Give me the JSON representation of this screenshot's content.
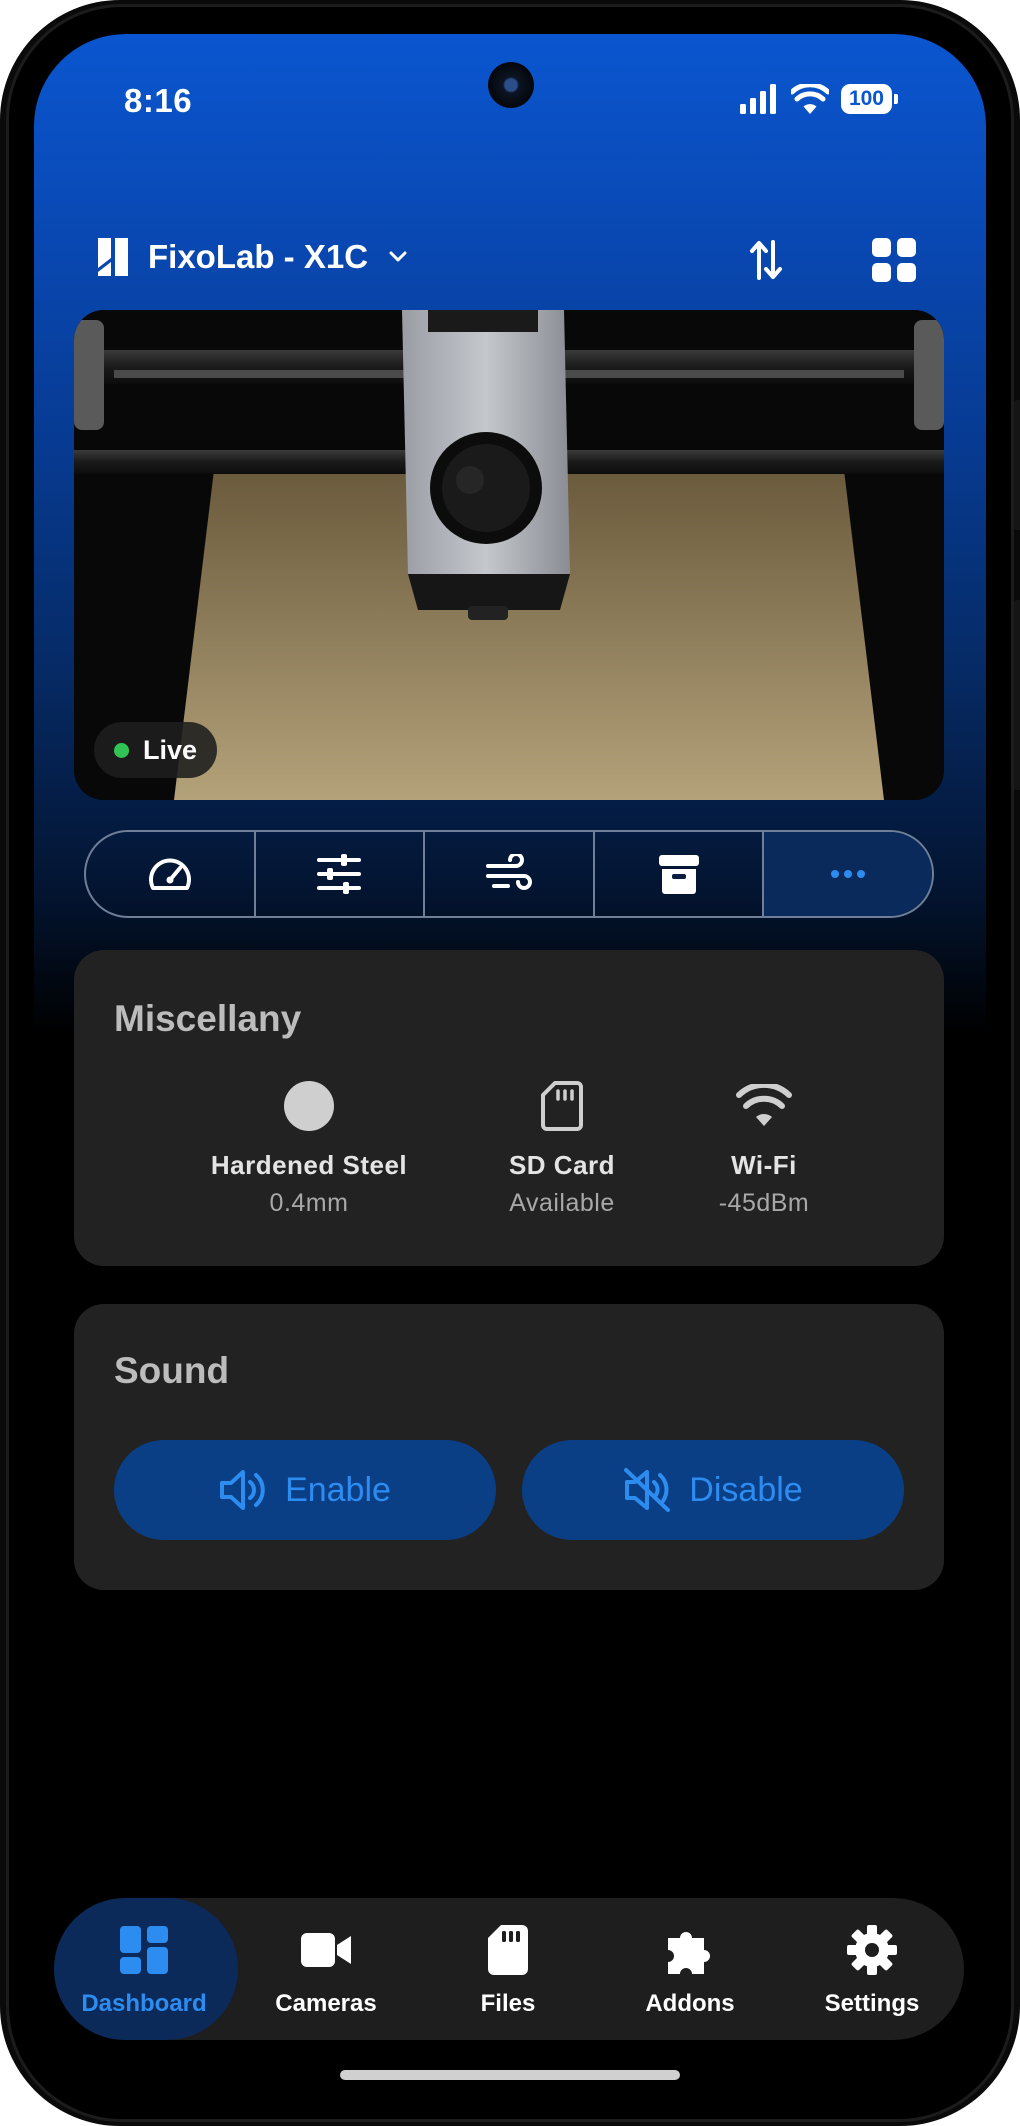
{
  "status_bar": {
    "time": "8:16",
    "battery": "100"
  },
  "header": {
    "printer_name": "FixoLab - X1C"
  },
  "camera": {
    "live_label": "Live"
  },
  "control_tabs": [
    {
      "icon": "speedometer-icon"
    },
    {
      "icon": "sliders-icon"
    },
    {
      "icon": "fan-icon"
    },
    {
      "icon": "archive-icon"
    },
    {
      "icon": "more-icon",
      "active": true
    }
  ],
  "miscellany": {
    "title": "Miscellany",
    "items": [
      {
        "icon": "nozzle-icon",
        "name": "Hardened Steel",
        "value": "0.4mm"
      },
      {
        "icon": "sd-card-icon",
        "name": "SD Card",
        "value": "Available"
      },
      {
        "icon": "wifi-icon",
        "name": "Wi-Fi",
        "value": "-45dBm"
      }
    ]
  },
  "sound": {
    "title": "Sound",
    "enable_label": "Enable",
    "disable_label": "Disable"
  },
  "bottom_nav": [
    {
      "label": "Dashboard",
      "icon": "dashboard-icon",
      "active": true
    },
    {
      "label": "Cameras",
      "icon": "video-camera-icon"
    },
    {
      "label": "Files",
      "icon": "sd-card-icon"
    },
    {
      "label": "Addons",
      "icon": "puzzle-icon"
    },
    {
      "label": "Settings",
      "icon": "gear-icon"
    }
  ],
  "colors": {
    "accent": "#2d8cf0",
    "card": "#222222",
    "live": "#31c455",
    "gradient_top": "#0a56d0"
  }
}
